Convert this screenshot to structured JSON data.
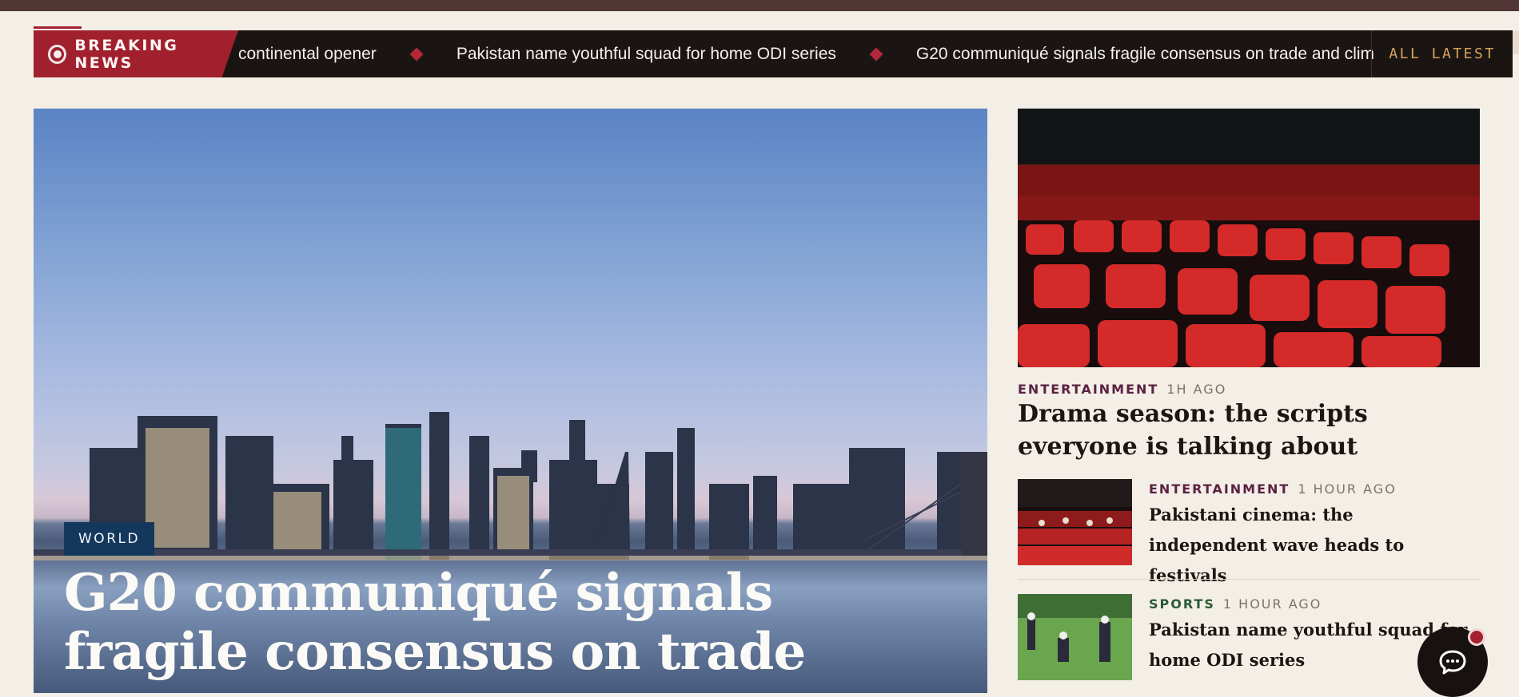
{
  "ticker": {
    "breaking_label": "BREAKING NEWS",
    "items": [
      "continental opener",
      "Pakistan name youthful squad for home ODI series",
      "G20 communiqué signals fragile consensus on trade and clim"
    ],
    "all_latest_label": "ALL LATEST"
  },
  "hero": {
    "category": "WORLD",
    "title": "G20 communiqué signals fragile consensus on trade"
  },
  "side": {
    "featured": {
      "category": "ENTERTAINMENT",
      "time": "1H AGO",
      "title": "Drama season: the scripts everyone is talking about"
    },
    "list": [
      {
        "category": "ENTERTAINMENT",
        "time": "1 HOUR AGO",
        "title": "Pakistani cinema: the independent wave heads to festivals"
      },
      {
        "category": "SPORTS",
        "time": "1 HOUR AGO",
        "title": "Pakistan name youthful squad for home ODI series"
      }
    ]
  },
  "colors": {
    "brand_red": "#a1202e",
    "ink": "#1c1513",
    "world_tag": "#14385d",
    "entertainment": "#5b2143",
    "sports": "#2a5a34"
  },
  "icons": [
    "live-dot-icon",
    "diamond-separator-icon",
    "chat-icon"
  ]
}
